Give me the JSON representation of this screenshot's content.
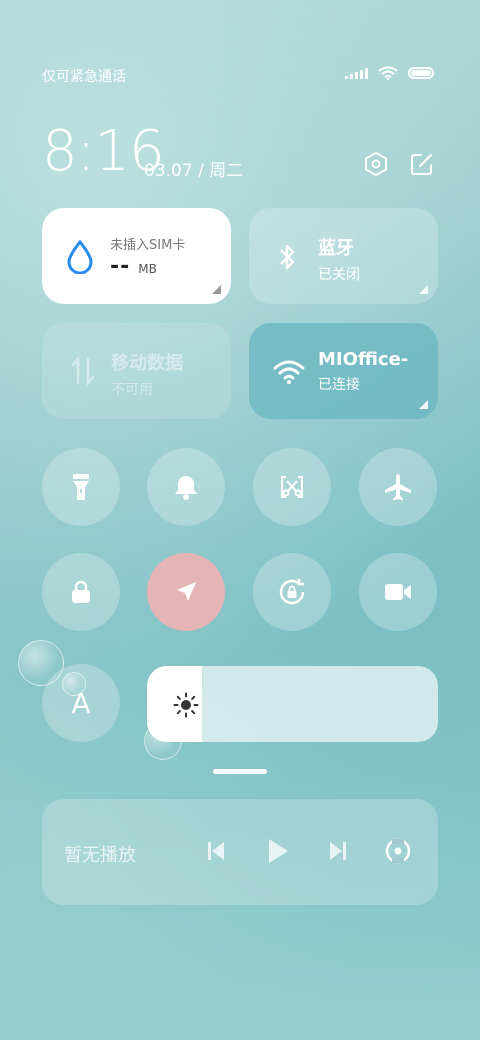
{
  "status_bar": {
    "carrier_text": "仅可紧急通话"
  },
  "header": {
    "time": "8:16",
    "date": "03.07 / 周二"
  },
  "tiles": {
    "data_usage": {
      "title": "未插入SIM卡",
      "value": "--",
      "unit": "MB"
    },
    "bluetooth": {
      "title": "蓝牙",
      "status": "已关闭"
    },
    "mobile_data": {
      "title": "移动数据",
      "status": "不可用"
    },
    "wifi": {
      "title": "MIOffice-",
      "status": "已连接"
    }
  },
  "toggles": [
    {
      "name": "flashlight-icon",
      "active": false
    },
    {
      "name": "bell-icon",
      "active": false
    },
    {
      "name": "screenshot-icon",
      "active": false
    },
    {
      "name": "airplane-icon",
      "active": false
    },
    {
      "name": "lock-icon",
      "active": false
    },
    {
      "name": "location-icon",
      "active": true
    },
    {
      "name": "rotation-lock-icon",
      "active": false
    },
    {
      "name": "video-icon",
      "active": false
    }
  ],
  "auto_brightness": {
    "label": "A"
  },
  "brightness": {
    "level": 0.19
  },
  "media": {
    "status_text": "暂无播放"
  },
  "colors": {
    "accent_location": "#e5b4b4",
    "water_blue": "#2b8bf0"
  }
}
